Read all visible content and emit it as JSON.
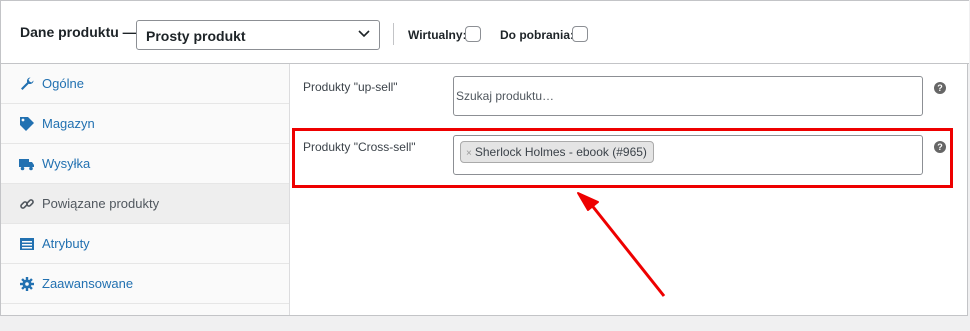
{
  "header": {
    "title": "Dane produktu —",
    "product_type": "Prosty produkt",
    "virtual_label": "Wirtualny:",
    "download_label": "Do pobrania:"
  },
  "sidebar": {
    "items": [
      {
        "label": "Ogólne",
        "icon": "wrench-icon"
      },
      {
        "label": "Magazyn",
        "icon": "tag-icon"
      },
      {
        "label": "Wysyłka",
        "icon": "truck-icon"
      },
      {
        "label": "Powiązane produkty",
        "icon": "link-icon",
        "active": true
      },
      {
        "label": "Atrybuty",
        "icon": "list-icon"
      },
      {
        "label": "Zaawansowane",
        "icon": "gear-icon"
      }
    ]
  },
  "fields": {
    "upsell_label": "Produkty \"up-sell\"",
    "upsell_placeholder": "Szukaj produktu…",
    "crosssell_label": "Produkty \"Cross-sell\"",
    "crosssell_token": "Sherlock Holmes - ebook (#965)",
    "help_glyph": "?"
  },
  "annotation": {
    "color": "#e00000"
  }
}
